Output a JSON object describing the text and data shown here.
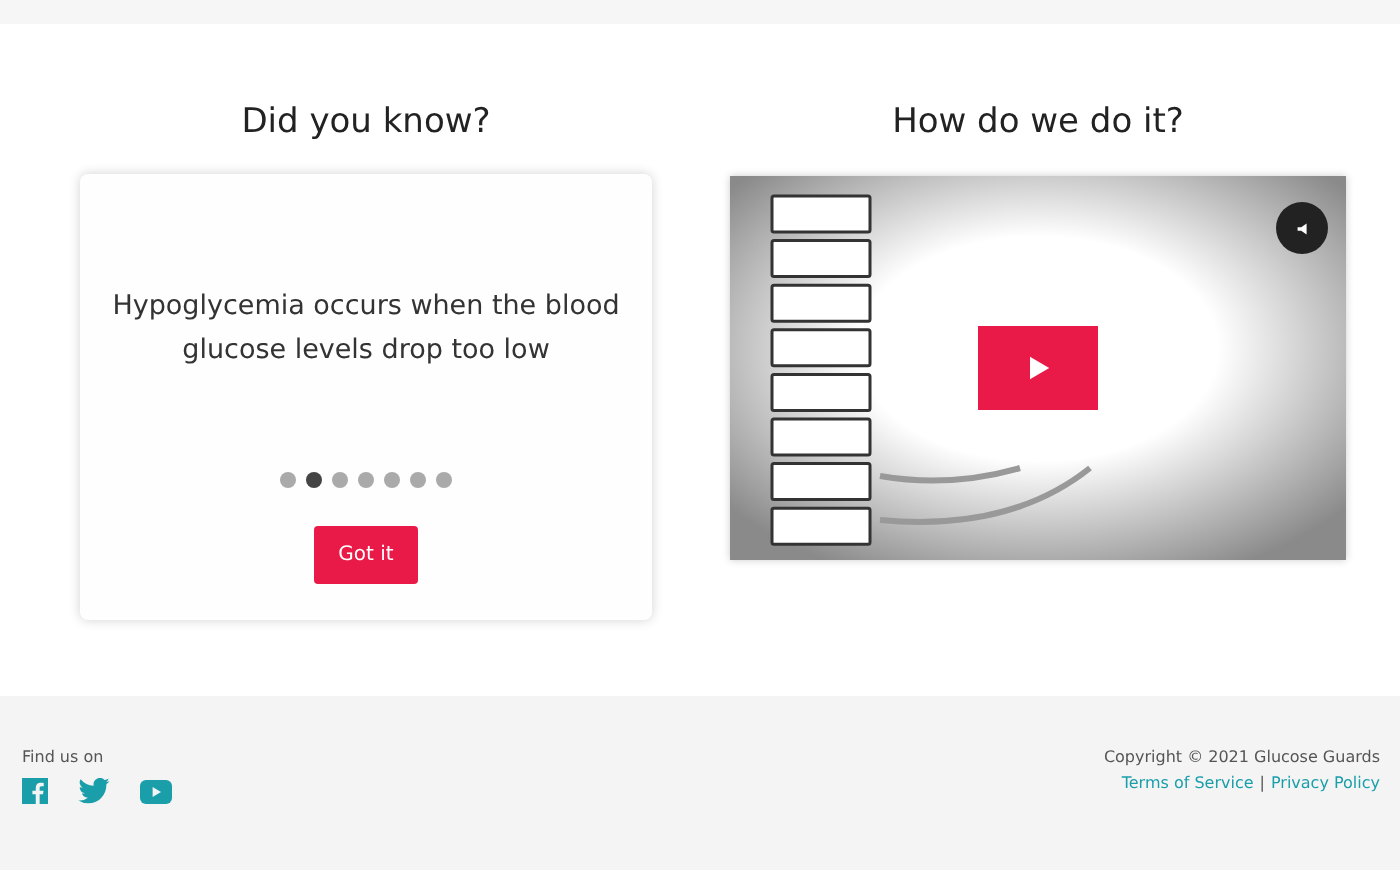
{
  "facts": {
    "heading": "Did you know?",
    "text": "Hypoglycemia occurs when the blood glucose levels drop too low",
    "dots": [
      {
        "selected": false
      },
      {
        "selected": true
      },
      {
        "selected": false
      },
      {
        "selected": false
      },
      {
        "selected": false
      },
      {
        "selected": false
      },
      {
        "selected": false
      }
    ],
    "button": "Got it"
  },
  "video": {
    "heading": "How do we do it?",
    "muted": true
  },
  "footer": {
    "find_us": "Find us on",
    "social": [
      {
        "kind": "facebook"
      },
      {
        "kind": "twitter"
      },
      {
        "kind": "youtube"
      }
    ],
    "copyright": "Copyright © 2021 Glucose Guards",
    "links": [
      "Terms of Service",
      "Privacy Policy"
    ],
    "separator": "|"
  }
}
